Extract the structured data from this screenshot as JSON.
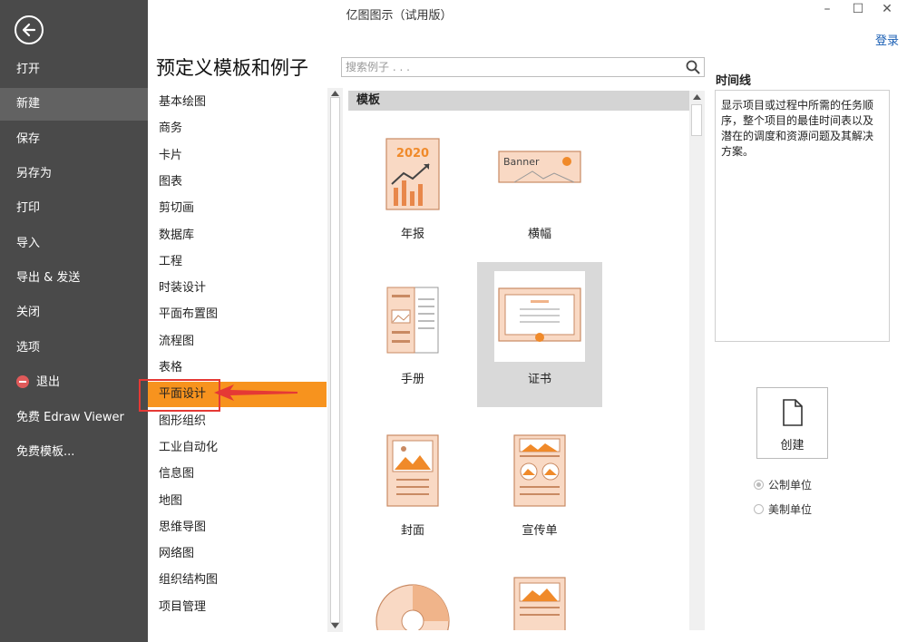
{
  "window": {
    "title": "亿图图示（试用版）",
    "minimize": "–",
    "maximize": "☐",
    "close": "✕",
    "login": "登录"
  },
  "sidebar": {
    "items": [
      {
        "label": "打开"
      },
      {
        "label": "新建",
        "active": true
      },
      {
        "label": "保存"
      },
      {
        "label": "另存为"
      },
      {
        "label": "打印"
      },
      {
        "label": "导入"
      },
      {
        "label": "导出 & 发送"
      },
      {
        "label": "关闭"
      },
      {
        "label": "选项"
      },
      {
        "label": "退出"
      },
      {
        "label": "免费 Edraw Viewer"
      },
      {
        "label": "免费模板..."
      }
    ]
  },
  "main": {
    "title": "预定义模板和例子",
    "search": {
      "placeholder": "搜索例子 . . ."
    }
  },
  "categories": [
    "基本绘图",
    "商务",
    "卡片",
    "图表",
    "剪切画",
    "数据库",
    "工程",
    "时装设计",
    "平面布置图",
    "流程图",
    "表格",
    "平面设计",
    "图形组织",
    "工业自动化",
    "信息图",
    "地图",
    "思维导图",
    "网络图",
    "组织结构图",
    "项目管理"
  ],
  "selected_category": "平面设计",
  "templates": {
    "header": "模板",
    "items": [
      {
        "label": "年报",
        "icon": "annual-report-icon",
        "thumb_text": "2020"
      },
      {
        "label": "横幅",
        "icon": "banner-icon",
        "thumb_text": "Banner"
      },
      {
        "label": "手册",
        "icon": "brochure-icon"
      },
      {
        "label": "证书",
        "icon": "certificate-icon",
        "selected": true
      },
      {
        "label": "封面",
        "icon": "cover-icon"
      },
      {
        "label": "宣传单",
        "icon": "flyer-icon"
      },
      {
        "label": "",
        "icon": "cd-icon"
      },
      {
        "label": "",
        "icon": "poster-icon"
      }
    ]
  },
  "details": {
    "title": "时间线",
    "description": "显示项目或过程中所需的任务顺序，整个项目的最佳时间表以及潜在的调度和资源问题及其解决方案。",
    "create_label": "创建",
    "units": [
      {
        "label": "公制单位",
        "checked": true
      },
      {
        "label": "美制单位",
        "checked": false
      }
    ]
  },
  "colors": {
    "accent": "#f7931e",
    "sidebar_bg": "#4a4a4a",
    "highlight_box": "#e53935",
    "thumb_fill": "#f9d9c4",
    "thumb_stroke": "#c98a63"
  }
}
